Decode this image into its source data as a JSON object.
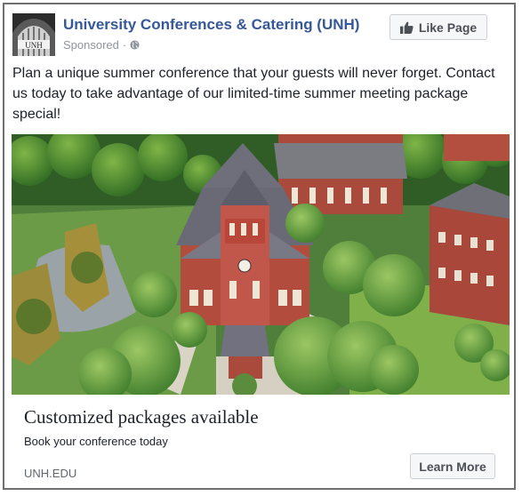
{
  "ad": {
    "page_name": "University Conferences & Catering (UNH)",
    "sponsored_label": "Sponsored",
    "separator": "·",
    "like_button_label": "Like Page",
    "body_text": "Plan a unique summer conference that your guests will never forget. Contact us today to take advantage of our limited-time summer meeting package special!",
    "link": {
      "headline": "Customized packages available",
      "description": "Book your conference today",
      "domain": "UNH.EDU",
      "cta_label": "Learn More"
    }
  },
  "icons": {
    "privacy": "globe-icon",
    "like": "thumbs-up-icon"
  },
  "colors": {
    "link_blue": "#365899",
    "meta_gray": "#90949c",
    "button_bg": "#f6f7f9",
    "border": "#6f6f6f"
  }
}
